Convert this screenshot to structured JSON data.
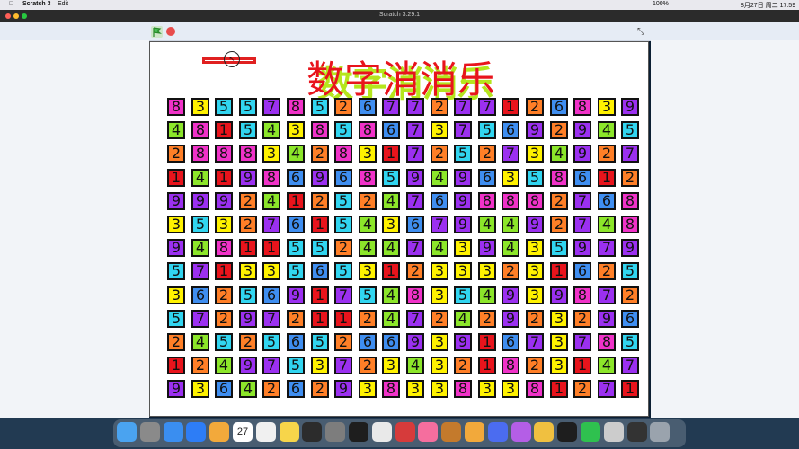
{
  "menubar": {
    "apple": "",
    "app": "Scratch 3",
    "edit": "Edit",
    "battery": "100%",
    "datetime": "8月27日 周二 17:59"
  },
  "window": {
    "title": "Scratch 3.29.1"
  },
  "stage": {
    "title": "数字消消乐",
    "title_shadow": "数字消消乐"
  },
  "grid": {
    "rows": [
      [
        8,
        3,
        5,
        5,
        7,
        8,
        5,
        2,
        6,
        7,
        7,
        2,
        7,
        7,
        1,
        2,
        6,
        8,
        3,
        9
      ],
      [
        4,
        8,
        1,
        5,
        4,
        3,
        8,
        5,
        8,
        6,
        7,
        3,
        7,
        5,
        6,
        9,
        2,
        9,
        4,
        5
      ],
      [
        2,
        8,
        8,
        8,
        3,
        4,
        2,
        8,
        3,
        1,
        7,
        2,
        5,
        2,
        7,
        3,
        4,
        9,
        2,
        7
      ],
      [
        1,
        4,
        1,
        9,
        8,
        6,
        9,
        6,
        8,
        5,
        9,
        4,
        9,
        6,
        3,
        5,
        8,
        6,
        1,
        2
      ],
      [
        9,
        9,
        9,
        2,
        4,
        1,
        2,
        5,
        2,
        4,
        7,
        6,
        9,
        8,
        8,
        8,
        2,
        7,
        6,
        8
      ],
      [
        3,
        5,
        3,
        2,
        7,
        6,
        1,
        5,
        4,
        3,
        6,
        7,
        9,
        4,
        4,
        9,
        2,
        7,
        4,
        8
      ],
      [
        9,
        4,
        8,
        1,
        1,
        5,
        5,
        2,
        4,
        4,
        7,
        4,
        3,
        9,
        4,
        3,
        5,
        9,
        7,
        9
      ],
      [
        5,
        7,
        1,
        3,
        3,
        5,
        6,
        5,
        3,
        1,
        2,
        3,
        3,
        3,
        2,
        3,
        1,
        6,
        2,
        5
      ],
      [
        3,
        6,
        2,
        5,
        6,
        9,
        1,
        7,
        5,
        4,
        8,
        3,
        5,
        4,
        9,
        3,
        9,
        8,
        7,
        2
      ],
      [
        5,
        7,
        2,
        9,
        7,
        2,
        1,
        1,
        2,
        4,
        7,
        2,
        4,
        2,
        9,
        2,
        3,
        2,
        9,
        6
      ],
      [
        2,
        4,
        5,
        2,
        5,
        6,
        5,
        2,
        6,
        6,
        9,
        3,
        9,
        1,
        6,
        7,
        3,
        7,
        8,
        5
      ],
      [
        1,
        2,
        4,
        9,
        7,
        5,
        3,
        7,
        2,
        3,
        4,
        3,
        2,
        1,
        8,
        2,
        3,
        1,
        4,
        7
      ],
      [
        9,
        3,
        6,
        4,
        2,
        6,
        2,
        9,
        3,
        8,
        3,
        3,
        8,
        3,
        3,
        8,
        1,
        2,
        7,
        1
      ]
    ],
    "colors": {
      "1": "#e8141c",
      "2": "#ff7f27",
      "3": "#fff200",
      "4": "#8ce62a",
      "5": "#31d5f0",
      "6": "#3f8ef0",
      "7": "#9b30f0",
      "8": "#f032c8",
      "9": "#9b30f0"
    }
  },
  "dock": {
    "icons": [
      "finder-icon",
      "launchpad-icon",
      "safari-icon",
      "appstore-icon",
      "photos-icon",
      "calendar-icon",
      "reminders-icon",
      "notes-icon",
      "activity-icon",
      "settings-icon",
      "terminal-icon",
      "chrome-icon",
      "xmind-icon",
      "bilibili-icon",
      "game-icon",
      "scratch-icon",
      "app-icon",
      "message-icon",
      "screencast-icon",
      "capcut-icon",
      "wechat-icon",
      "preview-icon",
      "window-icon",
      "trash-icon"
    ],
    "calendar_day": "27"
  }
}
